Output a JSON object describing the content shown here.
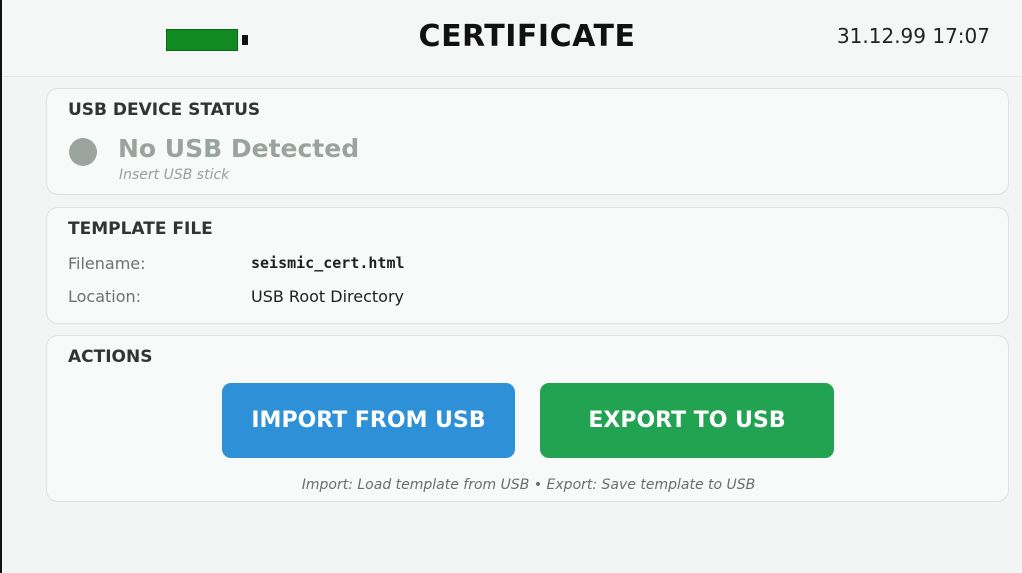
{
  "header": {
    "title": "CERTIFICATE",
    "datetime": "31.12.99 17:07",
    "battery_icon": "battery-icon",
    "battery_color": "#118a22"
  },
  "usb_status": {
    "section_title": "USB DEVICE STATUS",
    "status_text": "No USB Detected",
    "hint": "Insert USB stick",
    "indicator_color": "#9da4a0",
    "indicator_icon": "usb-status-indicator-icon"
  },
  "template_file": {
    "section_title": "TEMPLATE FILE",
    "filename_label": "Filename:",
    "filename_value": "seismic_cert.html",
    "location_label": "Location:",
    "location_value": "USB Root Directory"
  },
  "actions": {
    "section_title": "ACTIONS",
    "import_label": "IMPORT FROM USB",
    "export_label": "EXPORT TO USB",
    "hint": "Import: Load template from USB • Export: Save template to USB",
    "import_color": "#2e91d8",
    "export_color": "#22a352"
  }
}
